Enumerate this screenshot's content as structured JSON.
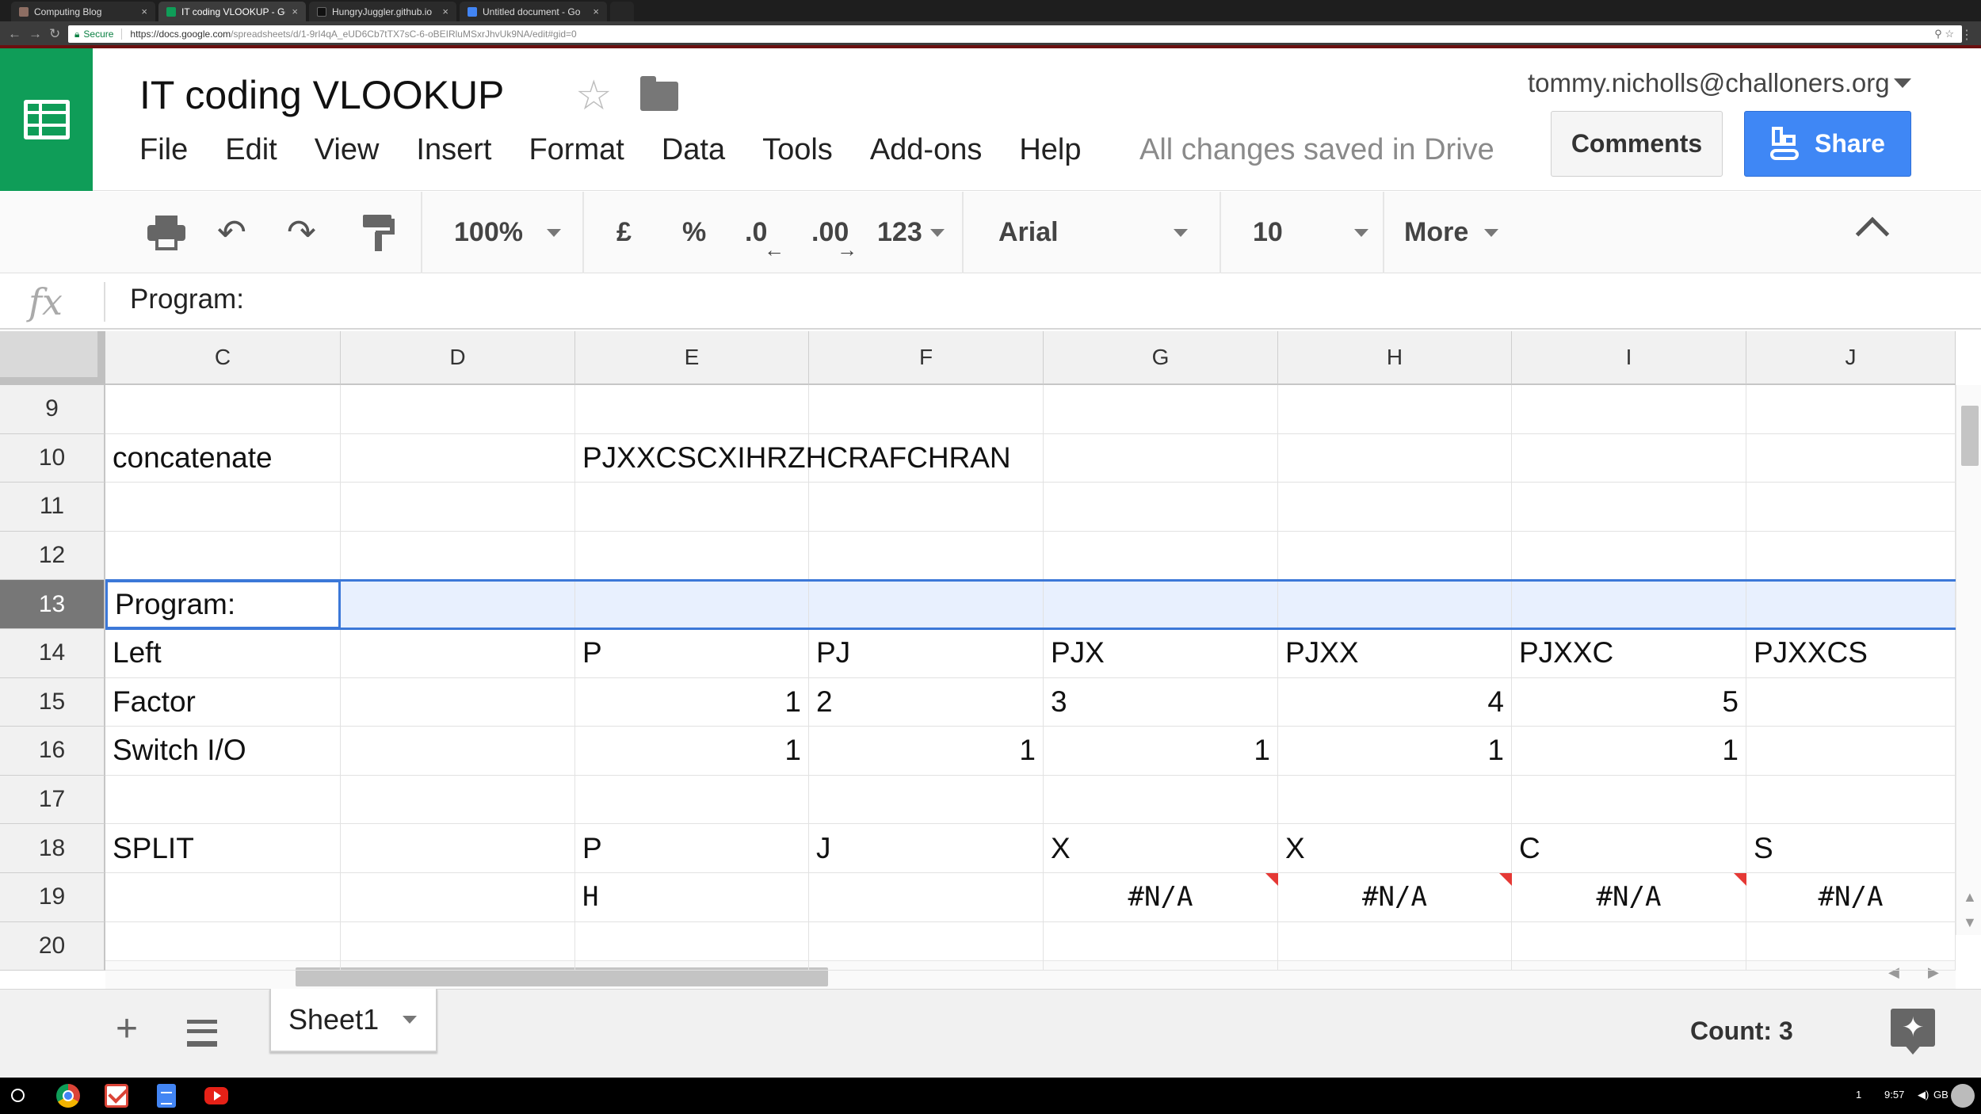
{
  "browser": {
    "tabs": [
      {
        "label": "Computing Blog",
        "active": false
      },
      {
        "label": "IT coding VLOOKUP - Go",
        "active": true
      },
      {
        "label": "HungryJuggler.github.io",
        "active": false
      },
      {
        "label": "Untitled document - Go",
        "active": false
      }
    ],
    "secure_label": "Secure",
    "url_host": "https://docs.google.com",
    "url_path": "/spreadsheets/d/1-9rI4qA_eUD6Cb7tTX7sC-6-oBEIRluMSxrJhvUk9NA/edit#gid=0"
  },
  "doc": {
    "title": "IT coding VLOOKUP",
    "menu": [
      "File",
      "Edit",
      "View",
      "Insert",
      "Format",
      "Data",
      "Tools",
      "Add-ons",
      "Help"
    ],
    "save_status": "All changes saved in Drive",
    "account": "tommy.nicholls@challoners.org",
    "comments_label": "Comments",
    "share_label": "Share"
  },
  "toolbar": {
    "zoom": "100%",
    "currency": "£",
    "percent": "%",
    "decrease_decimals": ".0",
    "increase_decimals": ".00",
    "number_format": "123",
    "font": "Arial",
    "font_size": "10",
    "more": "More"
  },
  "formula_bar": {
    "fx": "fx",
    "value": "Program:"
  },
  "grid": {
    "columns": [
      "C",
      "D",
      "E",
      "F",
      "G",
      "H",
      "I",
      "J"
    ],
    "rows": [
      "9",
      "10",
      "11",
      "12",
      "13",
      "14",
      "15",
      "16",
      "17",
      "18",
      "19",
      "20"
    ],
    "selected_row": "13",
    "cells": {
      "C10": "concatenate",
      "E10": "PJXXCSCXIHRZHCRAFCHRAN",
      "C13": "Program:",
      "C14": "Left",
      "E14": "P",
      "F14": "PJ",
      "G14": "PJX",
      "H14": "PJXX",
      "I14": "PJXXC",
      "J14": "PJXXCS",
      "C15": "Factor",
      "E15": "1",
      "F15": "2",
      "G15": "3",
      "H15": "4",
      "I15": "5",
      "C16": "Switch I/O",
      "E16": "1",
      "F16": "1",
      "G16": "1",
      "H16": "1",
      "I16": "1",
      "C18": "SPLIT",
      "E18": "P",
      "F18": "J",
      "G18": "X",
      "H18": "X",
      "I18": "C",
      "J18": "S",
      "E19": "H",
      "G19": "#N/A",
      "H19": "#N/A",
      "I19": "#N/A",
      "J19": "#N/A"
    }
  },
  "sheets": {
    "add_label": "+",
    "tabs": [
      "Sheet1"
    ],
    "count_label": "Count: 3"
  },
  "shelf": {
    "notification_count": "1",
    "time": "9:57",
    "locale": "GB"
  }
}
